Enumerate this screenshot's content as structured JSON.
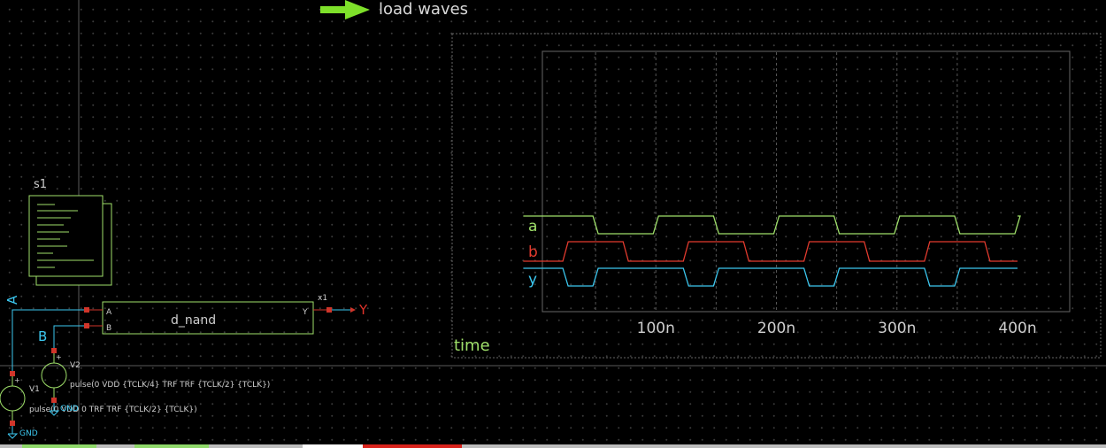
{
  "launcher": {
    "label": "load waves"
  },
  "symbol": {
    "name": "s1"
  },
  "instance": {
    "ref": "x1",
    "cell": "d_nand",
    "pin_a": "A",
    "pin_b": "B",
    "pin_y": "Y"
  },
  "nets": {
    "a": "A",
    "b": "B",
    "y": "Y",
    "gnd1": "GND",
    "gnd2": "GND"
  },
  "sources": {
    "v1": {
      "ref": "V1",
      "expr": "pulse(0 VDD 0 TRF TRF {TCLK/2} {TCLK})"
    },
    "v2": {
      "ref": "V2",
      "expr": "pulse(0 VDD {TCLK/4} TRF TRF {TCLK/2} {TCLK})"
    }
  },
  "plus_sign": "+",
  "minus_sign": "-",
  "chart_data": {
    "type": "line",
    "xlabel": "time",
    "x_ticks": [
      100,
      200,
      300,
      400
    ],
    "x_tick_labels": [
      "100n",
      "200n",
      "300n",
      "400n"
    ],
    "xlim": [
      0,
      440
    ],
    "grid": true,
    "series": [
      {
        "name": "a",
        "color": "#9fe06a",
        "period": 100,
        "phase": 0,
        "initial_high": true,
        "t_end": 400
      },
      {
        "name": "b",
        "color": "#e33b2e",
        "period": 100,
        "phase": 25,
        "initial_high": false,
        "t_end": 400
      },
      {
        "name": "y",
        "color": "#3cc8f0",
        "period": 100,
        "phase": 0,
        "initial_high": true,
        "t_end": 400,
        "type": "nand"
      }
    ]
  },
  "colors": {
    "wire": "#3cc8f0",
    "symbol": "#9fe06a",
    "pin": "#d0352a",
    "net_y": "#e0332a",
    "text": "#cfcfcf",
    "grid": "#555555"
  }
}
